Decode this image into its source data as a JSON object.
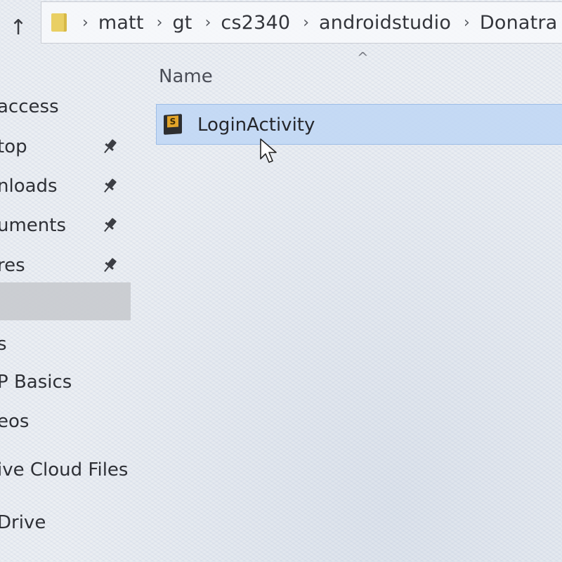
{
  "nav": {
    "up_icon": "arrow-up-icon",
    "up_glyph": "↑"
  },
  "address_bar": {
    "folder_icon": "folder-icon",
    "separator": "›",
    "crumbs": [
      "matt",
      "gt",
      "cs2340",
      "androidstudio",
      "Donatra"
    ]
  },
  "file_list": {
    "sort_indicator": "^",
    "column_header": "Name",
    "files": [
      {
        "name": "LoginActivity",
        "icon": "script-file-icon",
        "icon_letter": "S",
        "selected": true
      }
    ]
  },
  "sidebar": {
    "items": [
      {
        "label": "access",
        "pinned": false
      },
      {
        "label": "top",
        "pinned": true
      },
      {
        "label": "nloads",
        "pinned": true
      },
      {
        "label": "uments",
        "pinned": true
      },
      {
        "label": "res",
        "pinned": true
      },
      {
        "label": "",
        "pinned": false,
        "selected": true
      },
      {
        "label": "s",
        "pinned": false
      },
      {
        "label": "P Basics",
        "pinned": false
      },
      {
        "label": "eos",
        "pinned": false
      },
      {
        "label": "ive Cloud Files",
        "pinned": false
      },
      {
        "label": "Drive",
        "pinned": false
      }
    ]
  },
  "colors": {
    "selection": "#bed6f4",
    "sidebar_selected": "#c8cace",
    "folder": "#e9cf63"
  }
}
